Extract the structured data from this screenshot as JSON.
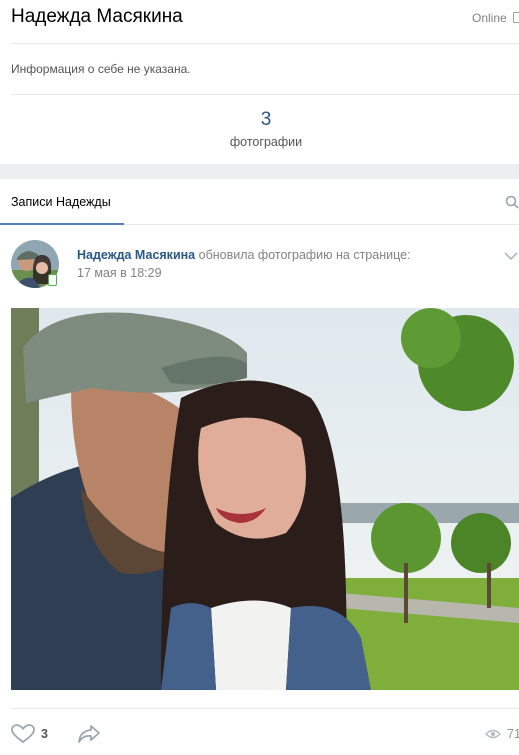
{
  "profile": {
    "name": "Надежда Масякина",
    "status": "Online",
    "about": "Информация о себе не указана.",
    "photos_count": "3",
    "photos_label": "фотографии"
  },
  "wall": {
    "tab_label": "Записи Надежды",
    "post": {
      "author": "Надежда Масякина",
      "action": "обновила фотографию на странице:",
      "date": "17 мая в 18:29",
      "likes": "3",
      "views": "71"
    }
  },
  "colors": {
    "link": "#2a5885",
    "accent": "#5181b8",
    "online_badge": "#4bb34b",
    "background": "#edeef0"
  },
  "icons": [
    "phone-icon",
    "search-icon",
    "chevron-down-icon",
    "mobile-icon",
    "heart-icon",
    "share-arrow-icon",
    "eye-icon"
  ]
}
